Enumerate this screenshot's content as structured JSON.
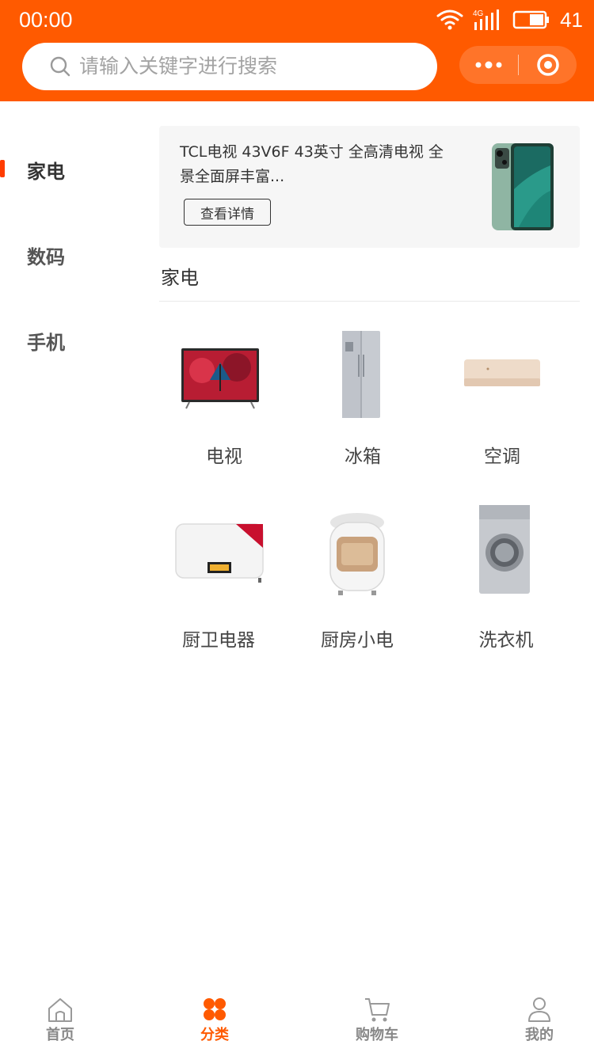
{
  "status_bar": {
    "time": "00:00",
    "network": "4G",
    "battery": "41"
  },
  "search": {
    "placeholder": "请输入关键字进行搜索"
  },
  "sidebar": {
    "items": [
      {
        "label": "家电",
        "active": true
      },
      {
        "label": "数码",
        "active": false
      },
      {
        "label": "手机",
        "active": false
      }
    ]
  },
  "banner": {
    "title": "TCL电视 43V6F 43英寸 全高清电视 全景全面屏丰富...",
    "button_label": "查看详情"
  },
  "section": {
    "title": "家电",
    "items": [
      {
        "label": "电视",
        "icon": "tv-image"
      },
      {
        "label": "冰箱",
        "icon": "fridge-image"
      },
      {
        "label": "空调",
        "icon": "air-conditioner-image"
      },
      {
        "label": "厨卫电器",
        "icon": "water-heater-image"
      },
      {
        "label": "厨房小电",
        "icon": "rice-cooker-image"
      },
      {
        "label": "洗衣机",
        "icon": "washing-machine-image"
      }
    ]
  },
  "tabbar": {
    "items": [
      {
        "label": "首页",
        "icon": "home-icon",
        "active": false
      },
      {
        "label": "分类",
        "icon": "category-icon",
        "active": true
      },
      {
        "label": "购物车",
        "icon": "cart-icon",
        "active": false
      },
      {
        "label": "我的",
        "icon": "user-icon",
        "active": false
      }
    ]
  },
  "colors": {
    "brand": "#ff5a00",
    "active_indicator": "#ff3c00",
    "text_primary": "#333333",
    "text_muted": "#888888"
  }
}
